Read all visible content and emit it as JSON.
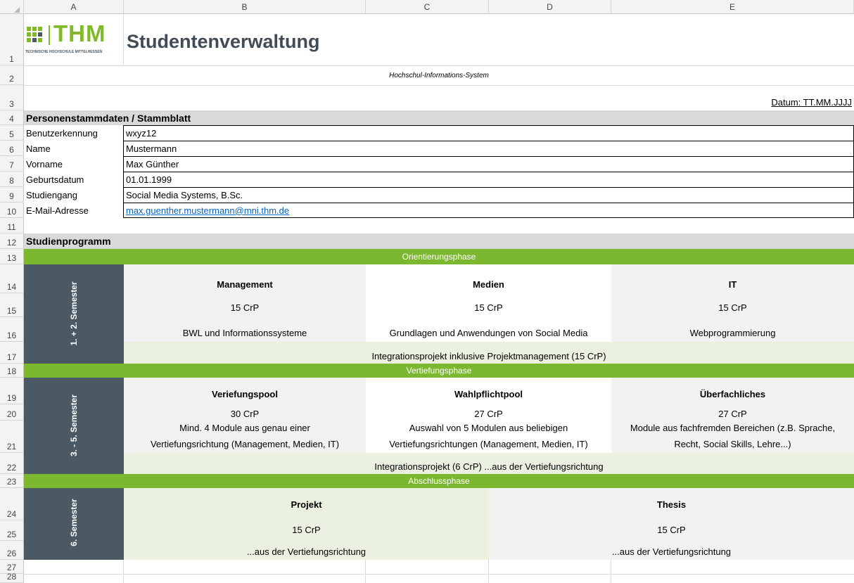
{
  "columns": [
    "A",
    "B",
    "C",
    "D",
    "E"
  ],
  "rows": [
    "1",
    "2",
    "3",
    "4",
    "5",
    "6",
    "7",
    "8",
    "9",
    "10",
    "11",
    "12",
    "13",
    "14",
    "15",
    "16",
    "17",
    "18",
    "19",
    "20",
    "21",
    "22",
    "23",
    "24",
    "25",
    "26",
    "27",
    "28"
  ],
  "logo": {
    "text": "THM",
    "subtitle": "TECHNISCHE HOCHSCHULE MITTELHESSEN"
  },
  "title": "Studentenverwaltung",
  "subtitle": "Hochschul-Informations-System",
  "date_label": "Datum: TT.MM.JJJJ",
  "personal": {
    "header": "Personenstammdaten / Stammblatt",
    "fields": [
      {
        "label": "Benutzerkennung",
        "value": "wxyz12"
      },
      {
        "label": "Name",
        "value": "Mustermann"
      },
      {
        "label": "Vorname",
        "value": "Max Günther"
      },
      {
        "label": "Geburtsdatum",
        "value": "01.01.1999"
      },
      {
        "label": "Studiengang",
        "value": "Social Media Systems, B.Sc."
      },
      {
        "label": "E-Mail-Adresse",
        "value": "max.guenther.mustermann@mni.thm.de"
      }
    ]
  },
  "program": {
    "header": "Studienprogramm",
    "phase1": {
      "title": "Orientierungsphase",
      "semester": "1. + 2. Semester",
      "modules": [
        {
          "name": "Management",
          "credits": "15 CrP",
          "desc": "BWL und Informationssysteme"
        },
        {
          "name": "Medien",
          "credits": "15 CrP",
          "desc": "Grundlagen und Anwendungen von Social Media"
        },
        {
          "name": "IT",
          "credits": "15 CrP",
          "desc": "Webprogrammierung"
        }
      ],
      "project": "Integrationsprojekt inklusive Projektmanagement (15 CrP)"
    },
    "phase2": {
      "title": "Vertiefungsphase",
      "semester": "3. - 5. Semester",
      "modules": [
        {
          "name": "Veriefungspool",
          "credits": "30 CrP",
          "desc1": "Mind. 4 Module aus genau einer",
          "desc2": "Vertiefungsrichtung (Management, Medien, IT)"
        },
        {
          "name": "Wahlpflichtpool",
          "credits": "27 CrP",
          "desc1": "Auswahl von 5 Modulen aus beliebigen",
          "desc2": "Vertiefungsrichtungen (Management, Medien, IT)"
        },
        {
          "name": "Überfachliches",
          "credits": "27 CrP",
          "desc1": "Module aus fachfremden Bereichen (z.B. Sprache,",
          "desc2": "Recht, Social Skills, Lehre...)"
        }
      ],
      "project": "Integrationsprojekt (6 CrP) ...aus der Vertiefungsrichtung"
    },
    "phase3": {
      "title": "Abschlussphase",
      "semester": "6. Semester",
      "modules": [
        {
          "name": "Projekt",
          "credits": "15 CrP",
          "desc": "...aus der Vertiefungsrichtung"
        },
        {
          "name": "Thesis",
          "credits": "15 CrP",
          "desc": "...aus der Vertiefungsrichtung"
        }
      ]
    }
  },
  "colors": {
    "green": "#7cb82f",
    "semester": "#4a5964",
    "light_green": "#eaf1e0",
    "band_gray": "#d9d9d9"
  }
}
